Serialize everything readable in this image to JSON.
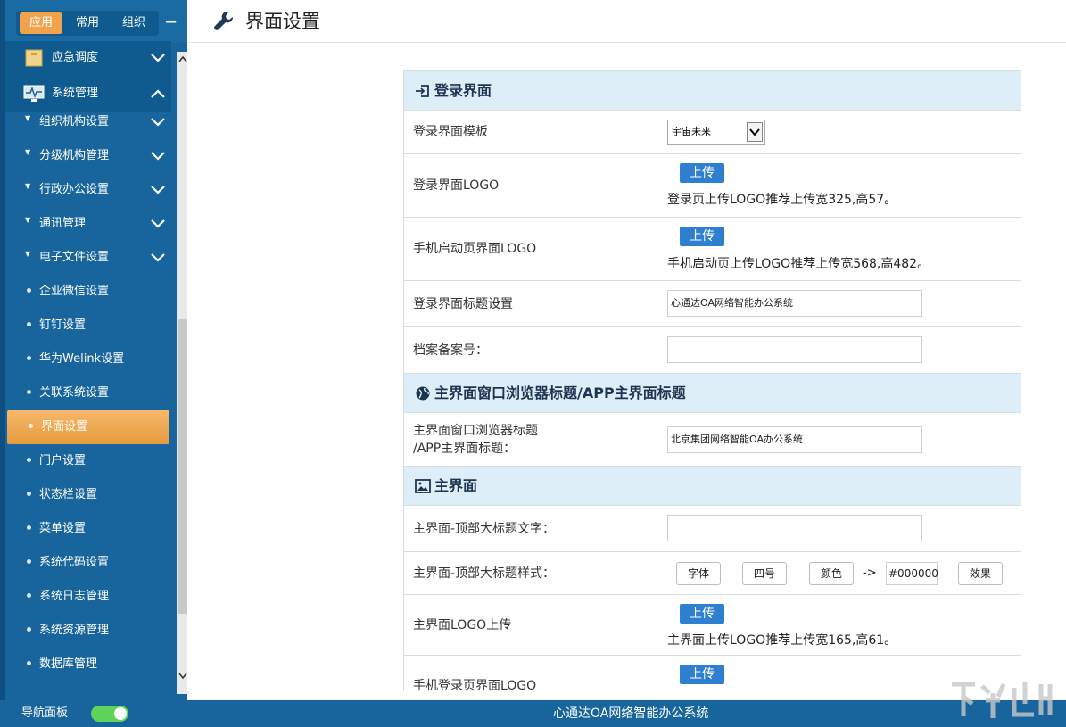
{
  "top_tabs": [
    "应用",
    "常用",
    "组织"
  ],
  "collapse_symbol": "−",
  "nav": {
    "sections": [
      {
        "label": "应急调度",
        "icon": "folder-icon"
      },
      {
        "label": "系统管理",
        "icon": "monitor-icon"
      }
    ],
    "items": [
      {
        "label": "组织机构设置",
        "type": "expand"
      },
      {
        "label": "分级机构管理",
        "type": "expand"
      },
      {
        "label": "行政办公设置",
        "type": "expand"
      },
      {
        "label": "通讯管理",
        "type": "expand"
      },
      {
        "label": "电子文件设置",
        "type": "expand"
      },
      {
        "label": "企业微信设置",
        "type": "leaf"
      },
      {
        "label": "钉钉设置",
        "type": "leaf"
      },
      {
        "label": "华为Welink设置",
        "type": "leaf"
      },
      {
        "label": "关联系统设置",
        "type": "leaf"
      },
      {
        "label": "界面设置",
        "type": "leaf",
        "active": true
      },
      {
        "label": "门户设置",
        "type": "leaf"
      },
      {
        "label": "状态栏设置",
        "type": "leaf"
      },
      {
        "label": "菜单设置",
        "type": "leaf"
      },
      {
        "label": "系统代码设置",
        "type": "leaf"
      },
      {
        "label": "系统日志管理",
        "type": "leaf"
      },
      {
        "label": "系统资源管理",
        "type": "leaf"
      },
      {
        "label": "数据库管理",
        "type": "leaf"
      }
    ]
  },
  "header": {
    "title": "界面设置",
    "icon": "wrench-icon"
  },
  "form": {
    "login_section": {
      "title": "登录界面",
      "icon": "login-icon"
    },
    "login_template": {
      "label": "登录界面模板",
      "value": "宇宙未来"
    },
    "login_logo": {
      "label": "登录界面LOGO",
      "button": "上传",
      "hint": "登录页上传LOGO推荐上传宽325,高57。"
    },
    "mobile_splash_logo": {
      "label": "手机启动页界面LOGO",
      "button": "上传",
      "hint": "手机启动页上传LOGO推荐上传宽568,高482。"
    },
    "login_title": {
      "label": "登录界面标题设置",
      "value": "心通达OA网络智能办公系统"
    },
    "record_no": {
      "label": "档案备案号：",
      "value": ""
    },
    "browser_section": {
      "title": "主界面窗口浏览器标题/APP主界面标题",
      "icon": "globe-icon"
    },
    "browser_title": {
      "label_line1": "主界面窗口浏览器标题",
      "label_line2": "/APP主界面标题：",
      "value": "北京集团网络智能OA办公系统"
    },
    "main_section": {
      "title": "主界面",
      "icon": "image-icon"
    },
    "main_top_text": {
      "label": "主界面-顶部大标题文字：",
      "value": ""
    },
    "main_top_style": {
      "label": "主界面-顶部大标题样式：",
      "font_btn": "字体",
      "size_btn": "四号",
      "color_btn": "颜色",
      "arrow": "->",
      "color_value": "#000000",
      "effect_btn": "效果"
    },
    "main_logo": {
      "label": "主界面LOGO上传",
      "button": "上传",
      "hint": "主界面上传LOGO推荐上传宽165,高61。"
    },
    "mobile_login_logo": {
      "label": "手机登录页界面LOGO",
      "button": "上传"
    }
  },
  "footer": {
    "nav_panel_label": "导航面板",
    "nav_panel_on": true,
    "title": "心通达OA网络智能办公系统"
  },
  "colors": {
    "sidebar": "#17659c",
    "active": "#f0a34a",
    "primary_button": "#2f7fd0",
    "section_bg": "#ddeef8",
    "toggle_on": "#5fd35b"
  }
}
